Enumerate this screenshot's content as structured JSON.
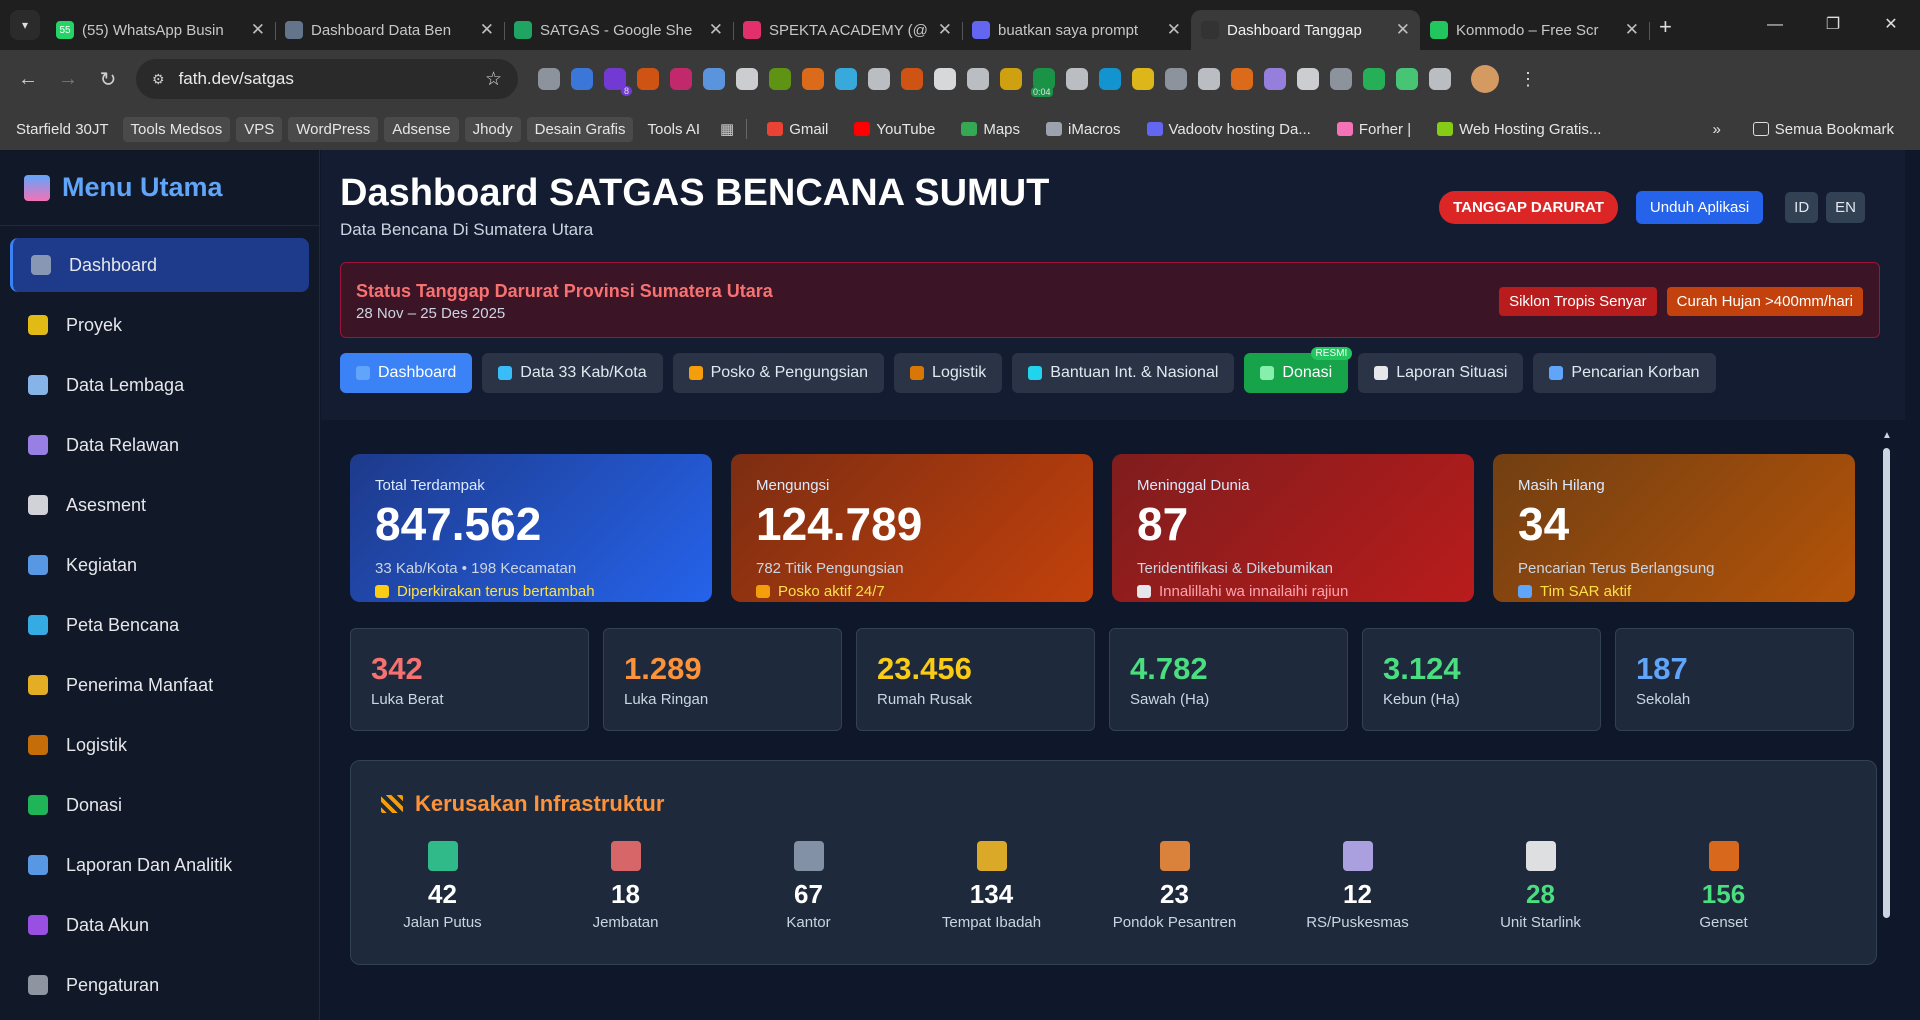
{
  "browser": {
    "tabs": [
      {
        "title": "(55) WhatsApp Busin",
        "color": "#25d366",
        "icon": "55"
      },
      {
        "title": "Dashboard Data Ben",
        "color": "#64748b",
        "icon": ""
      },
      {
        "title": "SATGAS - Google She",
        "color": "#1fa463",
        "icon": ""
      },
      {
        "title": "SPEKTA ACADEMY (@",
        "color": "#e1306c",
        "icon": ""
      },
      {
        "title": "buatkan saya prompt",
        "color": "#6366f1",
        "icon": ""
      },
      {
        "title": "Dashboard Tanggap",
        "color": "#333333",
        "icon": ""
      },
      {
        "title": "Kommodo – Free Scr",
        "color": "#22c55e",
        "icon": ""
      }
    ],
    "active_tab": 5,
    "url": "fath.dev/satgas",
    "bookmarks": [
      {
        "label": "Starfield 30JT",
        "hl": false
      },
      {
        "label": "Tools Medsos",
        "hl": true
      },
      {
        "label": "VPS",
        "hl": true
      },
      {
        "label": "WordPress",
        "hl": true
      },
      {
        "label": "Adsense",
        "hl": true
      },
      {
        "label": "Jhody",
        "hl": true
      },
      {
        "label": "Desain Grafis",
        "hl": true
      },
      {
        "label": "Tools AI",
        "hl": false
      }
    ],
    "bookmarks_icons": [
      {
        "label": "Gmail",
        "color": "#ea4335"
      },
      {
        "label": "YouTube",
        "color": "#ff0000"
      },
      {
        "label": "Maps",
        "color": "#34a853"
      },
      {
        "label": "iMacros",
        "color": "#9ca3af"
      },
      {
        "label": "Vadootv hosting Da...",
        "color": "#6366f1"
      },
      {
        "label": "Forher |",
        "color": "#f472b6"
      },
      {
        "label": "Web Hosting Gratis...",
        "color": "#84cc16"
      }
    ],
    "all_bookmarks": "Semua Bookmark",
    "ext_badge_1": "8",
    "ext_badge_2": "0:04"
  },
  "sidebar": {
    "title": "Menu Utama",
    "items": [
      {
        "label": "Dashboard",
        "color": "#94a3b8",
        "active": true
      },
      {
        "label": "Proyek",
        "color": "#facc15"
      },
      {
        "label": "Data Lembaga",
        "color": "#93c5fd"
      },
      {
        "label": "Data Relawan",
        "color": "#a78bfa"
      },
      {
        "label": "Asesment",
        "color": "#e5e7eb"
      },
      {
        "label": "Kegiatan",
        "color": "#60a5fa"
      },
      {
        "label": "Peta Bencana",
        "color": "#38bdf8"
      },
      {
        "label": "Penerima Manfaat",
        "color": "#fbbf24"
      },
      {
        "label": "Logistik",
        "color": "#d97706"
      },
      {
        "label": "Donasi",
        "color": "#22c55e"
      },
      {
        "label": "Laporan Dan Analitik",
        "color": "#60a5fa"
      },
      {
        "label": "Data Akun",
        "color": "#a855f7"
      },
      {
        "label": "Pengaturan",
        "color": "#9ca3af"
      }
    ]
  },
  "header": {
    "title": "Dashboard SATGAS BENCANA SUMUT",
    "subtitle": "Data Bencana Di Sumatera Utara",
    "emergency_btn": "TANGGAP DARURAT",
    "download_btn": "Unduh Aplikasi",
    "lang_id": "ID",
    "lang_en": "EN"
  },
  "alert": {
    "title": "Status Tanggap Darurat Provinsi Sumatera Utara",
    "period": "28 Nov – 25 Des 2025",
    "tags": [
      {
        "label": "Siklon Tropis Senyar",
        "color": "#b91c1c"
      },
      {
        "label": "Curah Hujan >400mm/hari",
        "color": "#c2410c"
      }
    ]
  },
  "nav_tabs": [
    {
      "label": "Dashboard",
      "style": "active",
      "icon_color": "#60a5fa"
    },
    {
      "label": "Data 33 Kab/Kota",
      "style": "",
      "icon_color": "#38bdf8"
    },
    {
      "label": "Posko & Pengungsian",
      "style": "",
      "icon_color": "#f59e0b"
    },
    {
      "label": "Logistik",
      "style": "",
      "icon_color": "#d97706"
    },
    {
      "label": "Bantuan Int. & Nasional",
      "style": "",
      "icon_color": "#22d3ee"
    },
    {
      "label": "Donasi",
      "style": "green",
      "icon_color": "#86efac",
      "badge": "RESMI"
    },
    {
      "label": "Laporan Situasi",
      "style": "",
      "icon_color": "#e5e7eb"
    },
    {
      "label": "Pencarian Korban",
      "style": "",
      "icon_color": "#60a5fa"
    }
  ],
  "big_cards": [
    {
      "label": "Total Terdampak",
      "value": "847.562",
      "sub": "33 Kab/Kota • 198 Kecamatan",
      "note": "Diperkirakan terus bertambah",
      "bg": "linear-gradient(135deg,#1e3a8a,#2563eb)",
      "note_color": "#fde047",
      "icon_color": "#facc15"
    },
    {
      "label": "Mengungsi",
      "value": "124.789",
      "sub": "782 Titik Pengungsian",
      "note": "Posko aktif 24/7",
      "bg": "linear-gradient(135deg,#7c2d12,#c2410c)",
      "note_color": "#fde047",
      "icon_color": "#f59e0b"
    },
    {
      "label": "Meninggal Dunia",
      "value": "87",
      "sub": "Teridentifikasi & Dikebumikan",
      "note": "Innalillahi wa innailaihi rajiun",
      "bg": "linear-gradient(135deg,#7f1d1d,#b91c1c)",
      "note_color": "#fda4af",
      "icon_color": "#e5e7eb"
    },
    {
      "label": "Masih Hilang",
      "value": "34",
      "sub": "Pencarian Terus Berlangsung",
      "note": "Tim SAR aktif",
      "bg": "linear-gradient(135deg,#713f12,#b45309)",
      "note_color": "#fde047",
      "icon_color": "#60a5fa"
    }
  ],
  "small_cards": [
    {
      "value": "342",
      "label": "Luka Berat",
      "color": "#f87171"
    },
    {
      "value": "1.289",
      "label": "Luka Ringan",
      "color": "#fb923c"
    },
    {
      "value": "23.456",
      "label": "Rumah Rusak",
      "color": "#facc15"
    },
    {
      "value": "4.782",
      "label": "Sawah (Ha)",
      "color": "#4ade80"
    },
    {
      "value": "3.124",
      "label": "Kebun (Ha)",
      "color": "#4ade80"
    },
    {
      "value": "187",
      "label": "Sekolah",
      "color": "#60a5fa"
    }
  ],
  "infra": {
    "title": "Kerusakan Infrastruktur",
    "items": [
      {
        "value": "42",
        "label": "Jalan Putus",
        "icon_color": "#34d399",
        "num_color": "#ffffff"
      },
      {
        "value": "18",
        "label": "Jembatan",
        "icon_color": "#f87171",
        "num_color": "#ffffff"
      },
      {
        "value": "67",
        "label": "Kantor",
        "icon_color": "#94a3b8",
        "num_color": "#ffffff"
      },
      {
        "value": "134",
        "label": "Tempat Ibadah",
        "icon_color": "#fbbf24",
        "num_color": "#ffffff"
      },
      {
        "value": "23",
        "label": "Pondok Pesantren",
        "icon_color": "#fb923c",
        "num_color": "#ffffff"
      },
      {
        "value": "12",
        "label": "RS/Puskesmas",
        "icon_color": "#c4b5fd",
        "num_color": "#ffffff"
      },
      {
        "value": "28",
        "label": "Unit Starlink",
        "icon_color": "#ffffff",
        "num_color": "#4ade80"
      },
      {
        "value": "156",
        "label": "Genset",
        "icon_color": "#f97316",
        "num_color": "#4ade80"
      }
    ]
  }
}
